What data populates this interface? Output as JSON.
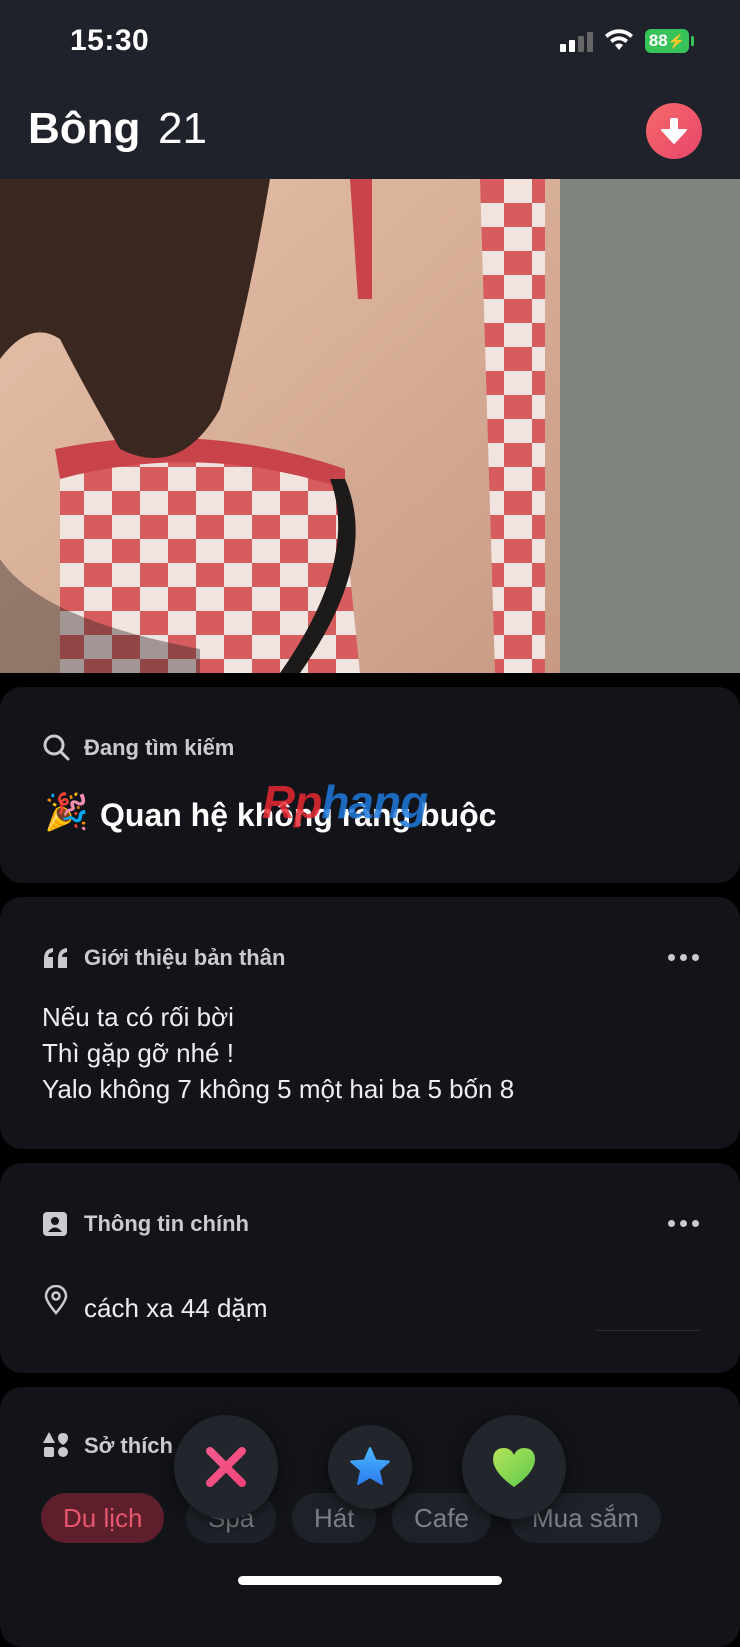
{
  "status_bar": {
    "time": "15:30",
    "battery": "88"
  },
  "header": {
    "name": "Bông",
    "age": "21"
  },
  "looking_for": {
    "title": "Đang tìm kiếm",
    "value": "Quan hệ không ràng buộc",
    "emoji": "🎉",
    "watermark": "Rphang"
  },
  "bio": {
    "title": "Giới thiệu bản thân",
    "lines": [
      "Nếu ta có rối bời",
      "Thì gặp gỡ nhé !",
      "Yalo không 7 không 5 một hai ba 5 bốn 8"
    ]
  },
  "basics": {
    "title": "Thông tin chính",
    "distance": "cách xa 44 dặm"
  },
  "interests": {
    "title": "Sở thích",
    "chips": [
      "Du lịch",
      "Spa",
      "Hát",
      "Cafe",
      "Mua sắm"
    ]
  },
  "colors": {
    "accent": "#e8456b",
    "card": "#121419",
    "header": "#1f222a",
    "like": "#7ed957",
    "superlike": "#3b9cff",
    "nope": "#f2457a"
  }
}
